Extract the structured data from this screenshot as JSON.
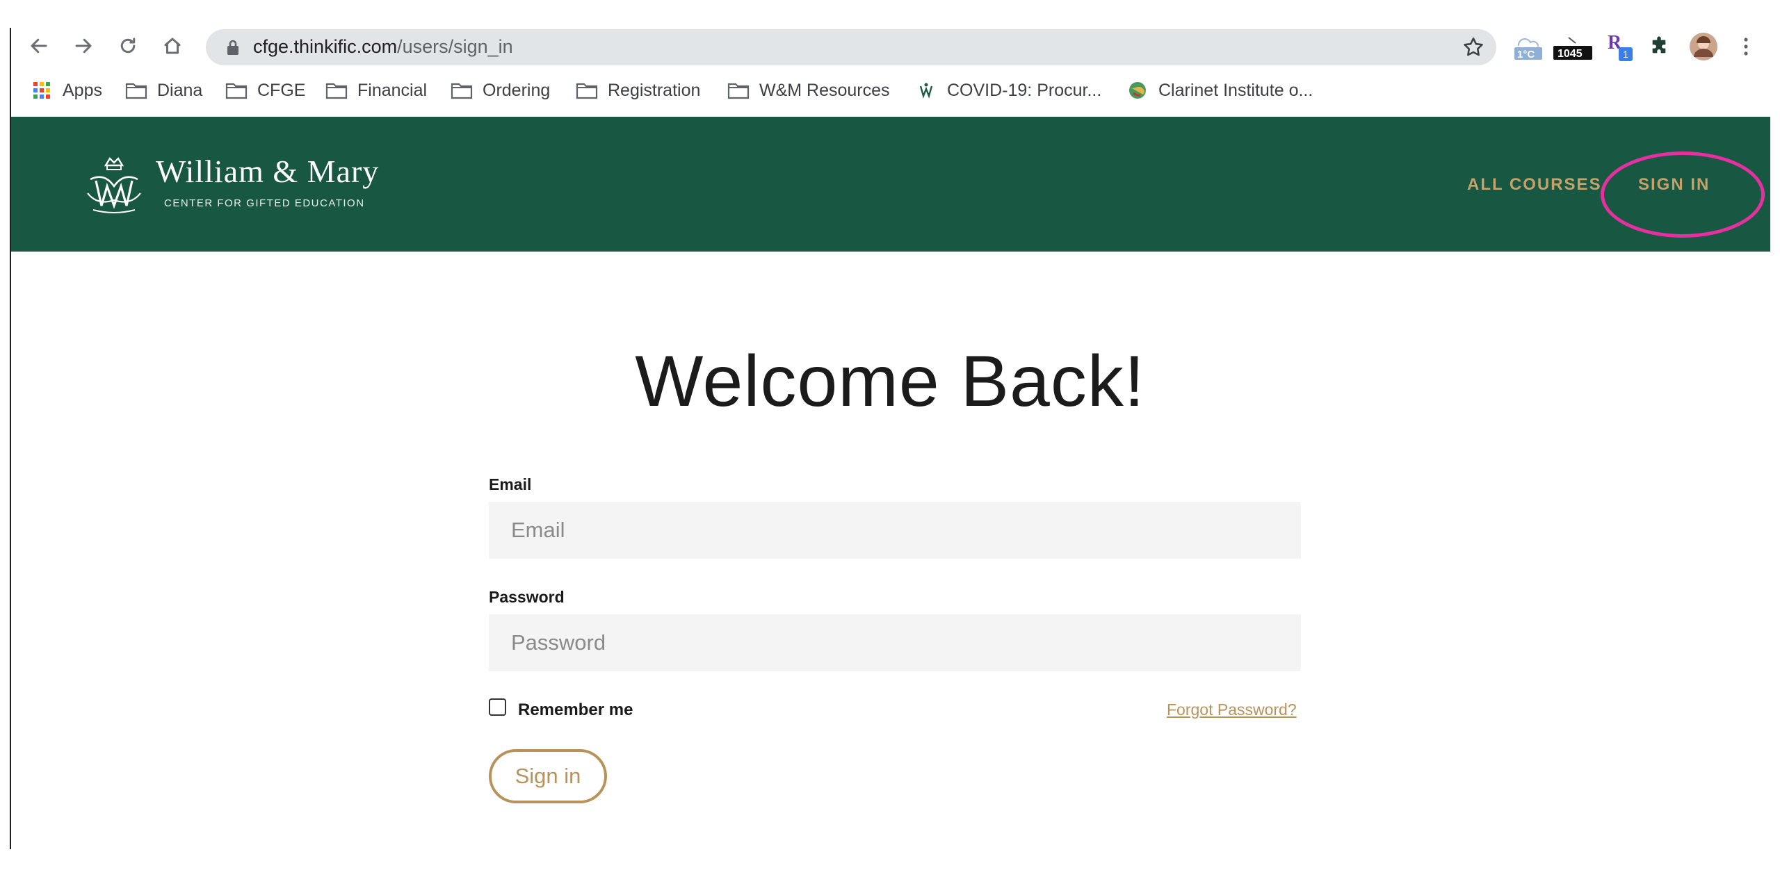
{
  "browser": {
    "url_host": "cfge.thinkific.com",
    "url_path": "/users/sign_in",
    "extensions": {
      "weather_temp": "1°C",
      "counter_badge": "1045",
      "r_badge": "1"
    }
  },
  "bookmarks": [
    {
      "label": "Apps",
      "icon": "apps-grid-icon"
    },
    {
      "label": "Diana",
      "icon": "folder-icon"
    },
    {
      "label": "CFGE",
      "icon": "folder-icon"
    },
    {
      "label": "Financial",
      "icon": "folder-icon"
    },
    {
      "label": "Ordering",
      "icon": "folder-icon"
    },
    {
      "label": "Registration",
      "icon": "folder-icon"
    },
    {
      "label": "W&M Resources",
      "icon": "folder-icon"
    },
    {
      "label": "COVID-19: Procur...",
      "icon": "wm-cypher-icon"
    },
    {
      "label": "Clarinet Institute o...",
      "icon": "globe-icon"
    }
  ],
  "site": {
    "logo_title": "William & Mary",
    "logo_subtitle": "CENTER FOR GIFTED EDUCATION",
    "nav": {
      "all_courses": "ALL COURSES",
      "sign_in": "SIGN IN"
    }
  },
  "form": {
    "heading": "Welcome Back!",
    "email_label": "Email",
    "email_placeholder": "Email",
    "password_label": "Password",
    "password_placeholder": "Password",
    "remember_label": "Remember me",
    "forgot_link": "Forgot Password?",
    "submit_label": "Sign in"
  },
  "colors": {
    "header_bg": "#185741",
    "accent_gold": "#b8925b",
    "annotation_pink": "#e62fa0"
  }
}
